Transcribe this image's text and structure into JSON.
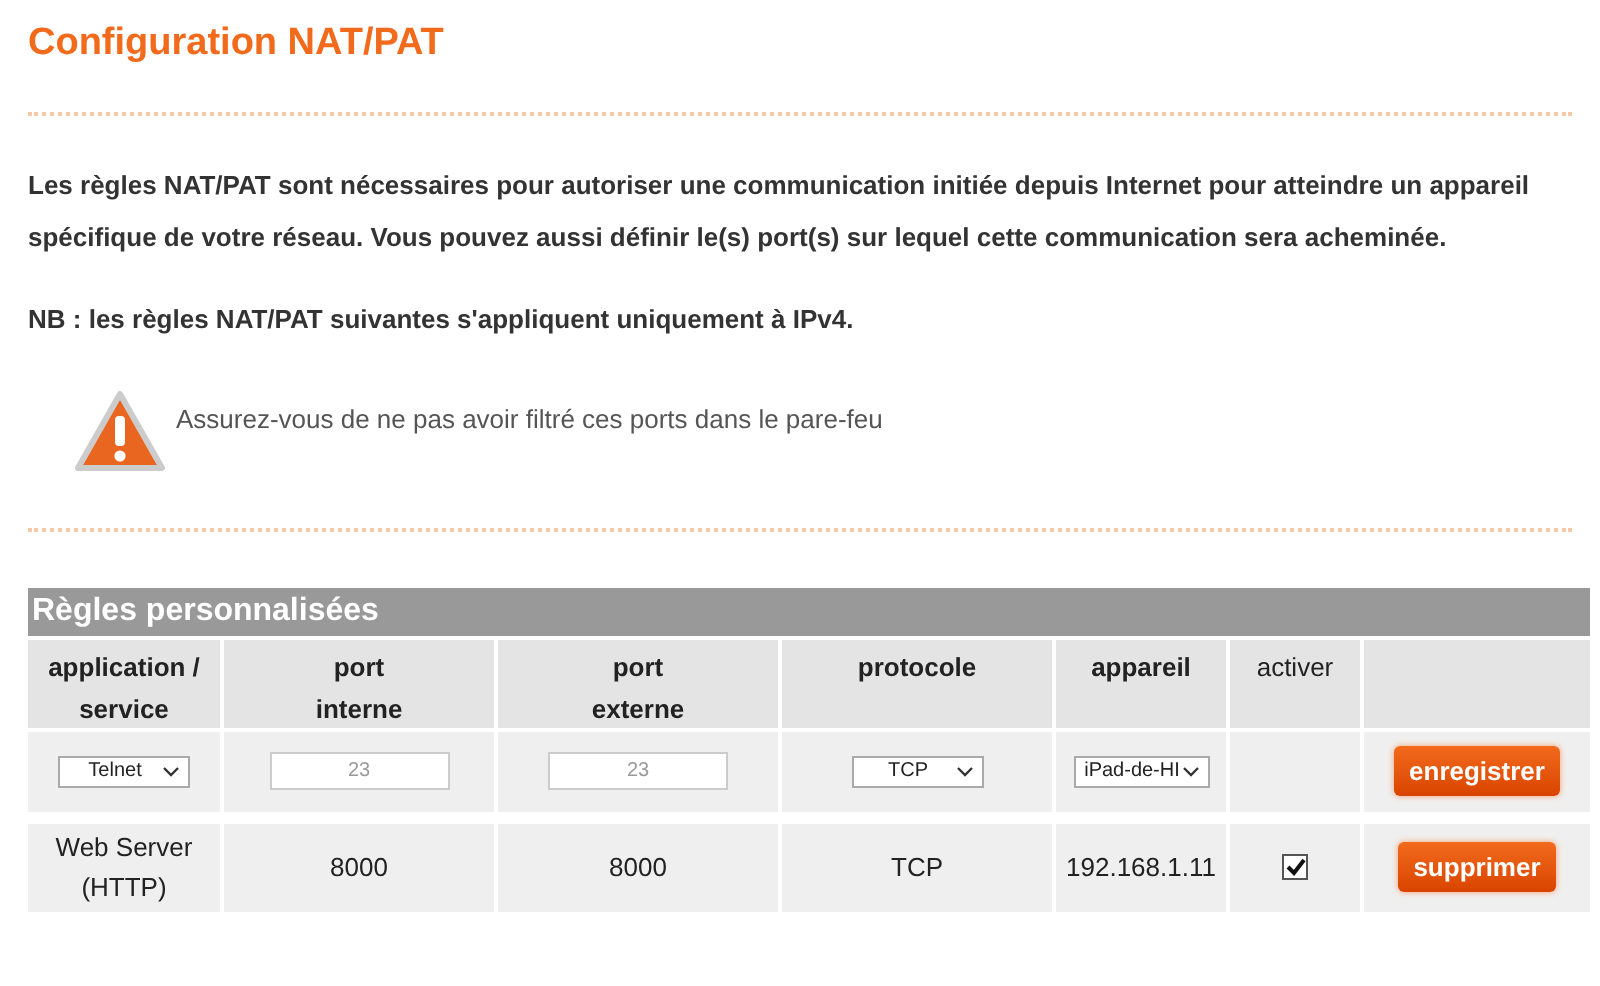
{
  "title": "Configuration NAT/PAT",
  "description": "Les règles NAT/PAT sont nécessaires pour autoriser une communication initiée depuis Internet pour atteindre un appareil spécifique de votre réseau. Vous pouvez aussi définir le(s) port(s) sur lequel cette communication sera acheminée.",
  "note": "NB : les règles NAT/PAT suivantes s'appliquent uniquement à IPv4.",
  "warning": "Assurez-vous de ne pas avoir filtré ces ports dans le pare-feu",
  "table": {
    "title": "Règles personnalisées",
    "columns": [
      {
        "line1": "application /",
        "line2": "service",
        "bold": true
      },
      {
        "line1": "port",
        "line2": "interne",
        "bold": true
      },
      {
        "line1": "port",
        "line2": "externe",
        "bold": true
      },
      {
        "line1": "protocole",
        "bold": true
      },
      {
        "line1": "appareil",
        "bold": true
      },
      {
        "line1": "activer",
        "bold": false
      }
    ],
    "new_rule": {
      "service": "Telnet",
      "port_internal_placeholder": "23",
      "port_external_placeholder": "23",
      "protocol": "TCP",
      "device": "iPad-de-HI",
      "button": "enregistrer"
    },
    "rules": [
      {
        "service": "Web Server (HTTP)",
        "port_internal": "8000",
        "port_external": "8000",
        "protocol": "TCP",
        "device": "192.168.1.11",
        "checked": true,
        "button": "supprimer"
      }
    ]
  }
}
